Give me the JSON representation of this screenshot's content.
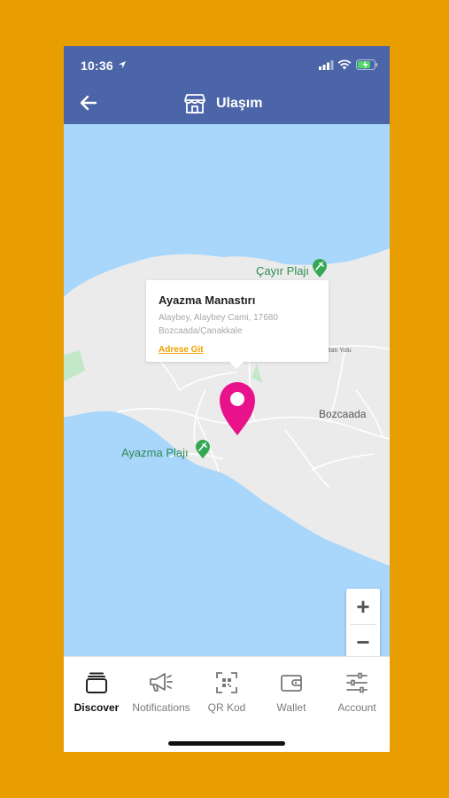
{
  "status": {
    "time": "10:36"
  },
  "header": {
    "title": "Ulaşım"
  },
  "map": {
    "pois": [
      {
        "name": "Çayır Plajı"
      },
      {
        "name": "Ayazma Plajı"
      }
    ],
    "town": "Bozcaada",
    "road": "Batı Yolu",
    "callout": {
      "title": "Ayazma Manastırı",
      "address": "Alaybey, Alaybey Cami, 17680 Bozcaada/Çanakkale",
      "link": "Adrese Git"
    },
    "zoom": {
      "in": "+",
      "out": "−"
    },
    "colors": {
      "water": "#A9D6FB",
      "land": "#EBEBEB",
      "pin": "#E8138A",
      "poi": "#2E8B57"
    }
  },
  "tabs": [
    {
      "label": "Discover",
      "icon": "stack-icon",
      "active": true
    },
    {
      "label": "Notifications",
      "icon": "megaphone-icon",
      "active": false
    },
    {
      "label": "QR Kod",
      "icon": "qr-code-icon",
      "active": false
    },
    {
      "label": "Wallet",
      "icon": "wallet-icon",
      "active": false
    },
    {
      "label": "Account",
      "icon": "sliders-icon",
      "active": false
    }
  ],
  "colors": {
    "brand": "#4C65A8",
    "accent": "#F0A000",
    "background": "#E89E00"
  }
}
